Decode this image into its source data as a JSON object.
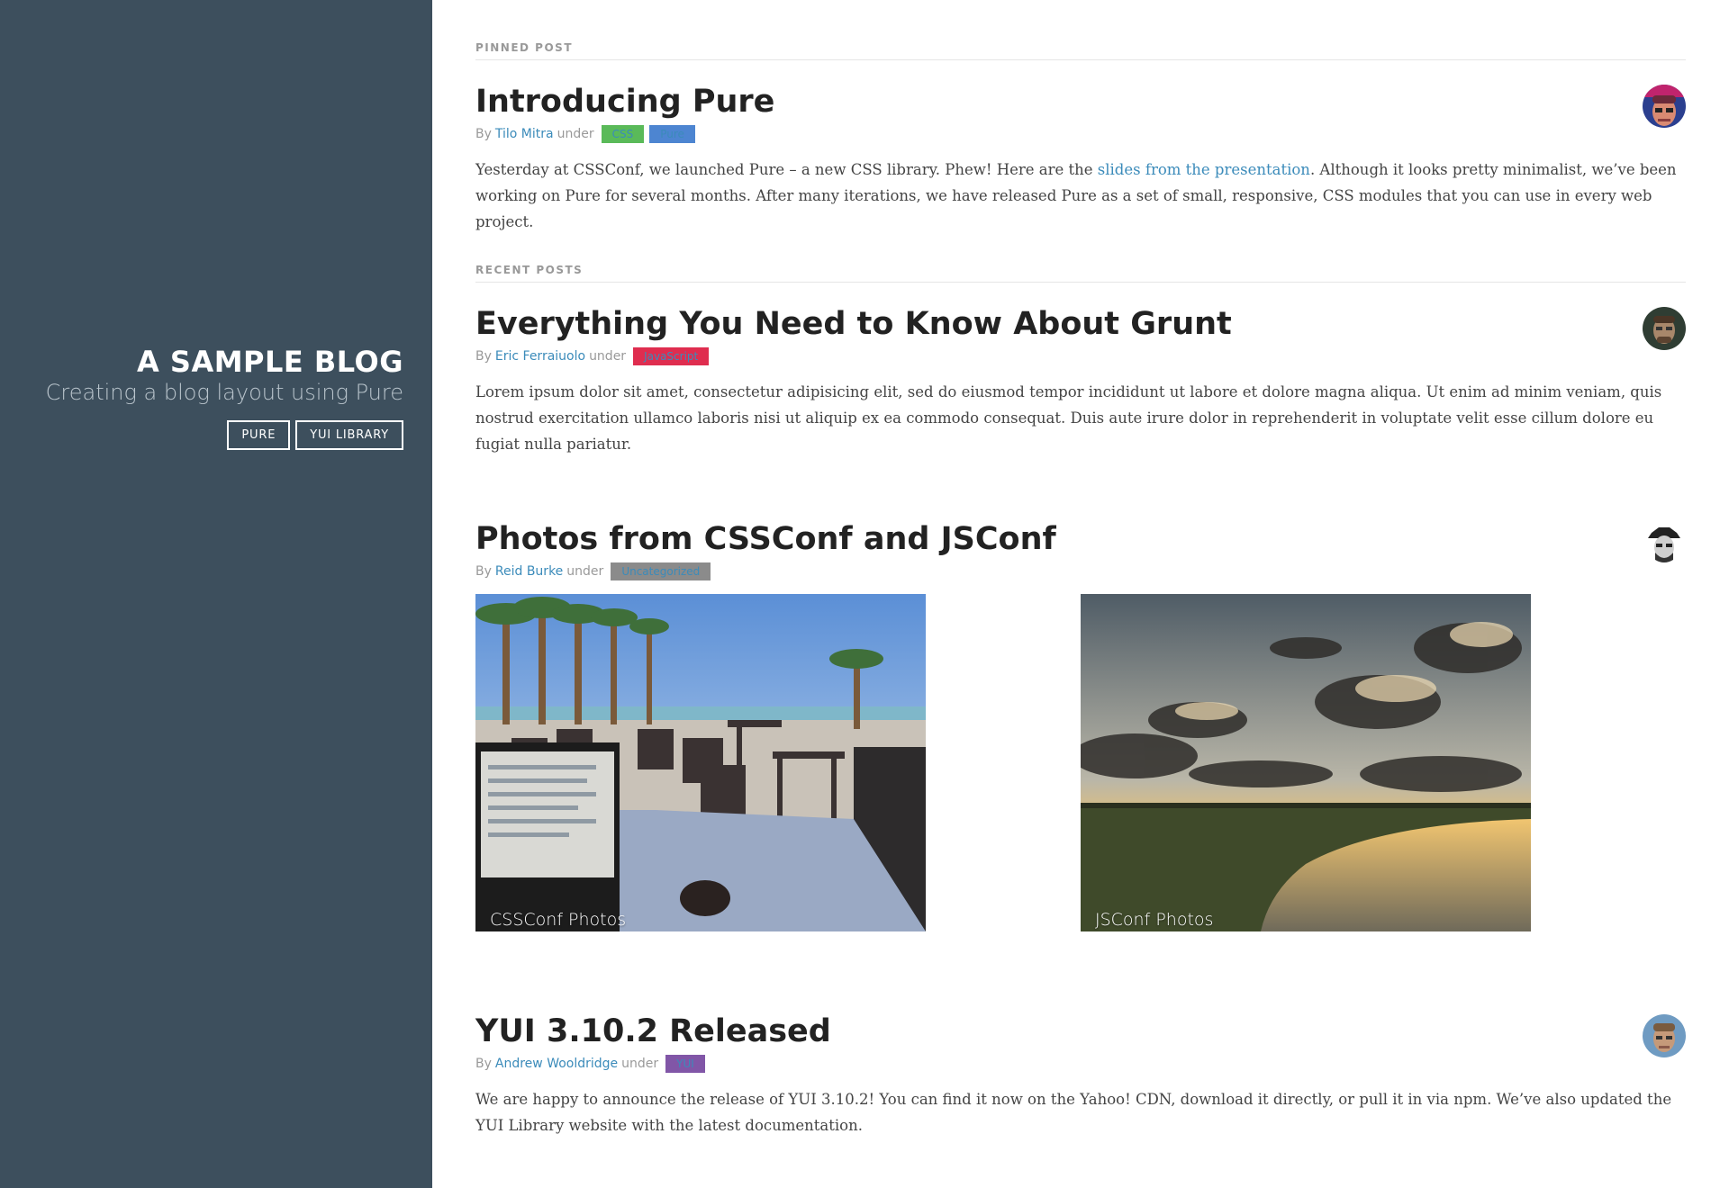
{
  "brand": {
    "title": "A SAMPLE BLOG",
    "tagline": "Creating a blog layout using Pure",
    "nav": [
      "PURE",
      "YUI LIBRARY"
    ]
  },
  "sections": {
    "pinned": "PINNED POST",
    "recent": "RECENT POSTS"
  },
  "posts": [
    {
      "title": "Introducing Pure",
      "by": "By",
      "author": "Tilo Mitra",
      "under": "under",
      "tags": [
        {
          "label": "CSS",
          "color": "#5aba59"
        },
        {
          "label": "Pure",
          "color": "#4d85d1"
        }
      ],
      "body_before": "Yesterday at CSSConf, we launched Pure – a new CSS library. Phew! Here are the ",
      "body_link": "slides from the presentation",
      "body_after": ". Although it looks pretty minimalist, we’ve been working on Pure for several months. After many iterations, we have released Pure as a set of small, responsive, CSS modules that you can use in every web project.",
      "avatar": "tilo-mitra-avatar"
    },
    {
      "title": "Everything You Need to Know About Grunt",
      "by": "By",
      "author": "Eric Ferraiuolo",
      "under": "under",
      "tags": [
        {
          "label": "JavaScript",
          "color": "#df2d4f"
        }
      ],
      "body": "Lorem ipsum dolor sit amet, consectetur adipisicing elit, sed do eiusmod tempor incididunt ut labore et dolore magna aliqua. Ut enim ad minim veniam, quis nostrud exercitation ullamco laboris nisi ut aliquip ex ea commodo consequat. Duis aute irure dolor in reprehenderit in voluptate velit esse cillum dolore eu fugiat nulla pariatur.",
      "avatar": "eric-ferraiuolo-avatar"
    },
    {
      "title": "Photos from CSSConf and JSConf",
      "by": "By",
      "author": "Reid Burke",
      "under": "under",
      "tags": [
        {
          "label": "Uncategorized",
          "color": "#8b8b8b"
        }
      ],
      "photos": [
        {
          "caption": "CSSConf Photos"
        },
        {
          "caption": "JSConf Photos"
        }
      ],
      "avatar": "reid-burke-avatar"
    },
    {
      "title": "YUI 3.10.2 Released",
      "by": "By",
      "author": "Andrew Wooldridge",
      "under": "under",
      "tags": [
        {
          "label": "YUI",
          "color": "#8156a7"
        }
      ],
      "body": "We are happy to announce the release of YUI 3.10.2! You can find it now on the Yahoo! CDN, download it directly, or pull it in via npm. We’ve also updated the YUI Library website with the latest documentation.",
      "avatar": "andrew-wooldridge-avatar"
    }
  ]
}
